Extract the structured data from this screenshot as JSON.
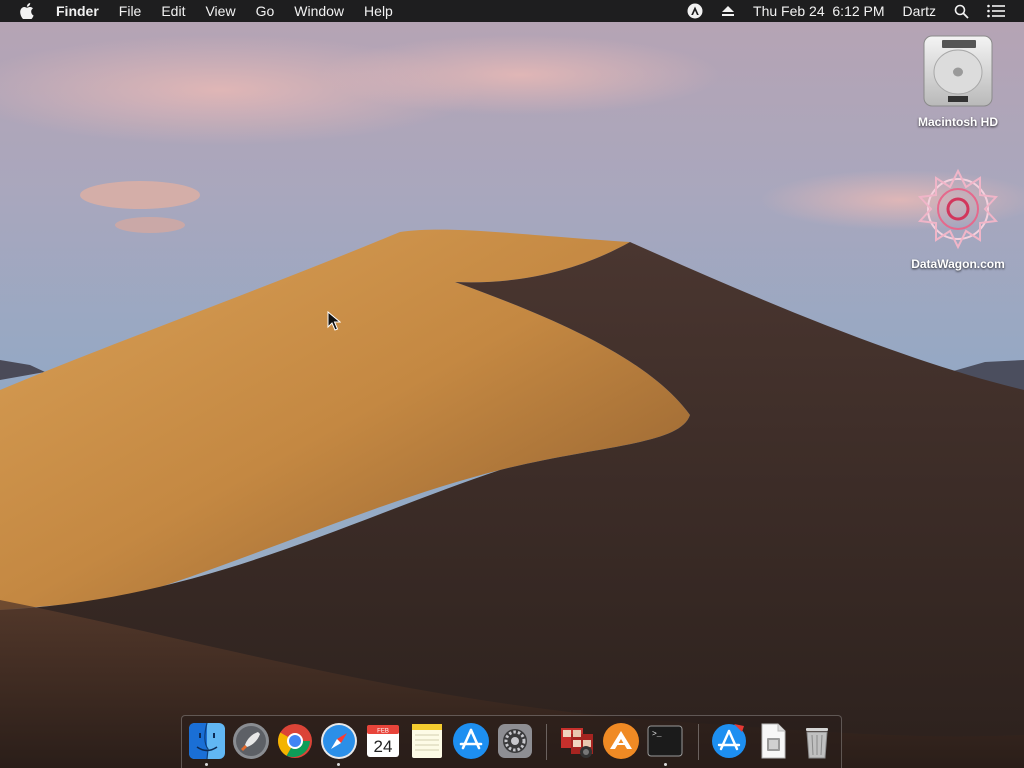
{
  "menubar": {
    "app_name": "Finder",
    "menus": [
      "File",
      "Edit",
      "View",
      "Go",
      "Window",
      "Help"
    ],
    "clock": "Thu Feb 24  6:12 PM",
    "user": "Dartz"
  },
  "desktop": {
    "icons": [
      {
        "label": "Macintosh HD",
        "icon": "hard-drive-icon"
      },
      {
        "label": "DataWagon.com",
        "icon": "datawagon-logo-icon"
      }
    ]
  },
  "dock": {
    "items": [
      {
        "name": "Finder",
        "icon": "finder-icon",
        "running": true
      },
      {
        "name": "Launchpad",
        "icon": "launchpad-icon",
        "running": false
      },
      {
        "name": "Google Chrome",
        "icon": "chrome-icon",
        "running": false
      },
      {
        "name": "Safari",
        "icon": "safari-icon",
        "running": true
      },
      {
        "name": "Calendar",
        "icon": "calendar-icon",
        "running": false,
        "month": "FEB",
        "day": "24"
      },
      {
        "name": "Notes",
        "icon": "notes-icon",
        "running": false
      },
      {
        "name": "App Store",
        "icon": "app-store-icon",
        "running": false
      },
      {
        "name": "System Preferences",
        "icon": "system-preferences-icon",
        "running": false
      },
      {
        "name": "Photo Booth",
        "icon": "photo-booth-icon",
        "running": false
      },
      {
        "name": "Transmit",
        "icon": "transmit-icon",
        "running": false
      },
      {
        "name": "Terminal",
        "icon": "terminal-icon",
        "running": true,
        "prompt": ">_"
      },
      {
        "name": "App Store",
        "icon": "app-store-download-icon",
        "running": false
      },
      {
        "name": "Document",
        "icon": "document-icon",
        "running": false
      },
      {
        "name": "Trash",
        "icon": "trash-icon",
        "running": false
      }
    ]
  },
  "colors": {
    "menubar": "#1e1e1f",
    "sky_top": "#b7a3b3",
    "sky_bottom": "#8fa8c6",
    "dune_light": "#c98f45",
    "dune_shadow": "#3b2b24"
  }
}
